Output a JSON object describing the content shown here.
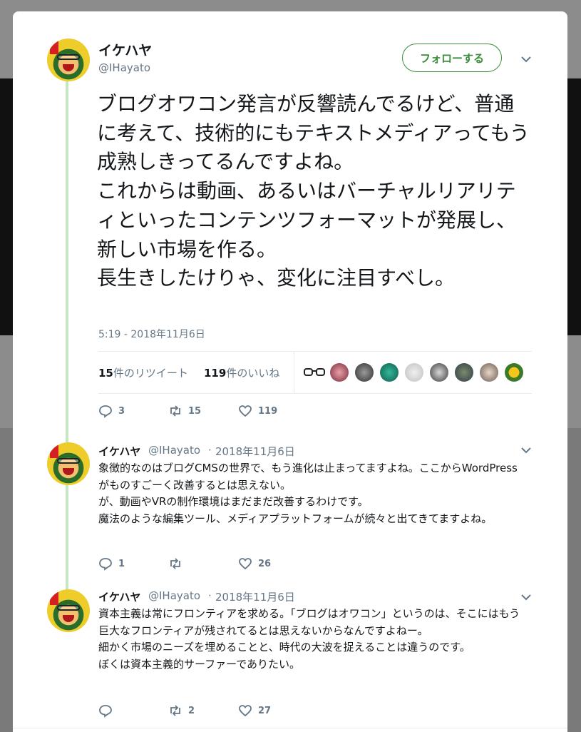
{
  "main_tweet": {
    "name": "イケハヤ",
    "handle": "@IHayato",
    "follow_label": "フォローする",
    "text": "ブログオワコン発言が反響読んでるけど、普通に考えて、技術的にもテキストメディアってもう成熟しきってるんですよね。\nこれからは動画、あるいはバーチャルリアリティといったコンテンツフォーマットが発展し、新しい市場を作る。\n長生きしたけりゃ、変化に注目すべし。",
    "timestamp": "5:19 - 2018年11月6日",
    "retweet_count": "15",
    "retweet_label": "件のリツイート",
    "like_count": "119",
    "like_label": "件のいいね",
    "replies": "3",
    "retweets": "15",
    "likes": "119"
  },
  "replies": [
    {
      "name": "イケハヤ",
      "handle": "@IHayato",
      "sep": "·",
      "date": "2018年11月6日",
      "text": "象徴的なのはブログCMSの世界で、もう進化は止まってますよね。ここからWordPressがものすごーく改善するとは思えない。\nが、動画やVRの制作環境はまだまだ改善するわけです。\n魔法のような編集ツール、メディアプラットフォームが続々と出てきてますよね。",
      "replies": "1",
      "retweets": "",
      "likes": "26"
    },
    {
      "name": "イケハヤ",
      "handle": "@IHayato",
      "sep": "·",
      "date": "2018年11月6日",
      "text": "資本主義は常にフロンティアを求める。「ブログはオワコン」というのは、そこにはもう巨大なフロンティアが残されてるとは思えないからなんですよねー。\n細かく市場のニーズを埋めることと、時代の大波を捉えることは違うのです。\nぼくは資本主義的サーファーでありたい。",
      "replies": "",
      "retweets": "2",
      "likes": "27"
    }
  ],
  "colors": {
    "accent": "#3a8d3a",
    "thread": "#c6e6c3",
    "muted": "#657786"
  }
}
